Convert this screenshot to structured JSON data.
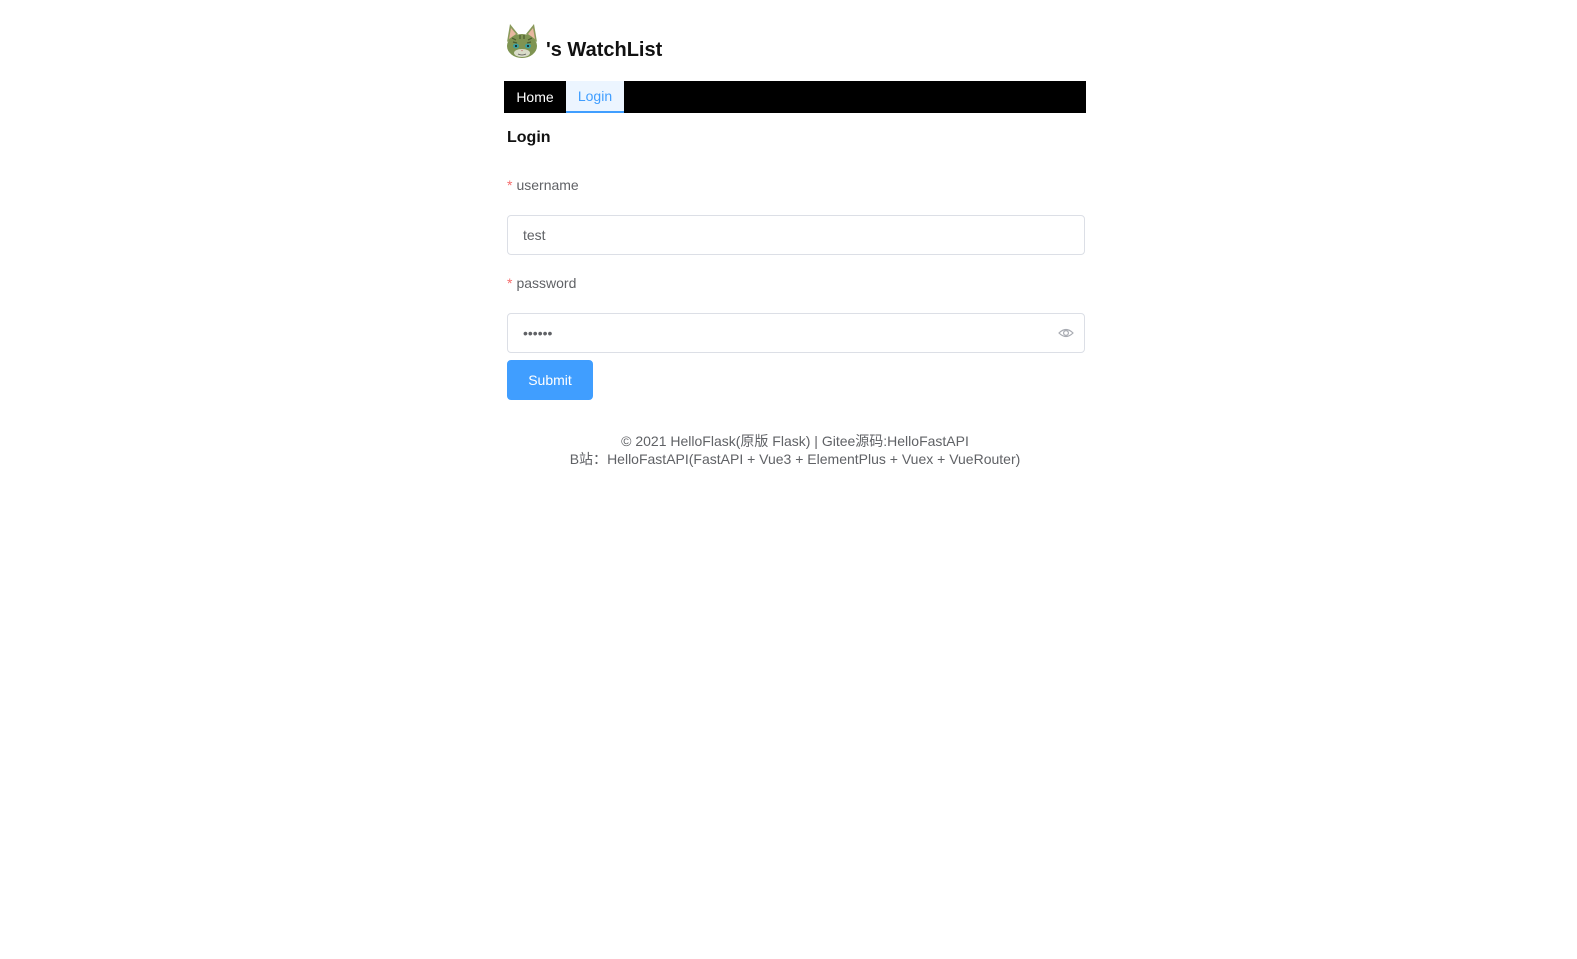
{
  "header": {
    "avatar_icon": "cat-avatar-icon",
    "title": "'s WatchList"
  },
  "nav": {
    "items": [
      {
        "label": "Home",
        "active": false
      },
      {
        "label": "Login",
        "active": true
      }
    ]
  },
  "form": {
    "title": "Login",
    "required_mark": "*",
    "username": {
      "label": "username",
      "value": "test"
    },
    "password": {
      "label": "password",
      "value": "••••••",
      "toggle_icon": "eye-icon"
    },
    "submit_label": "Submit"
  },
  "footer": {
    "line1_prefix": "© 2021 ",
    "line1_link1": "HelloFlask(原版 Flask)",
    "line1_sep": " | ",
    "line1_link2": "Gitee源码:HelloFastAPI",
    "line2_prefix": "B站：",
    "line2_link": "HelloFastAPI(FastAPI + Vue3 + ElementPlus + Vuex + VueRouter)"
  },
  "colors": {
    "accent": "#409eff",
    "nav_bg": "#000000",
    "required": "#f56c6c",
    "text_muted": "#606266"
  }
}
